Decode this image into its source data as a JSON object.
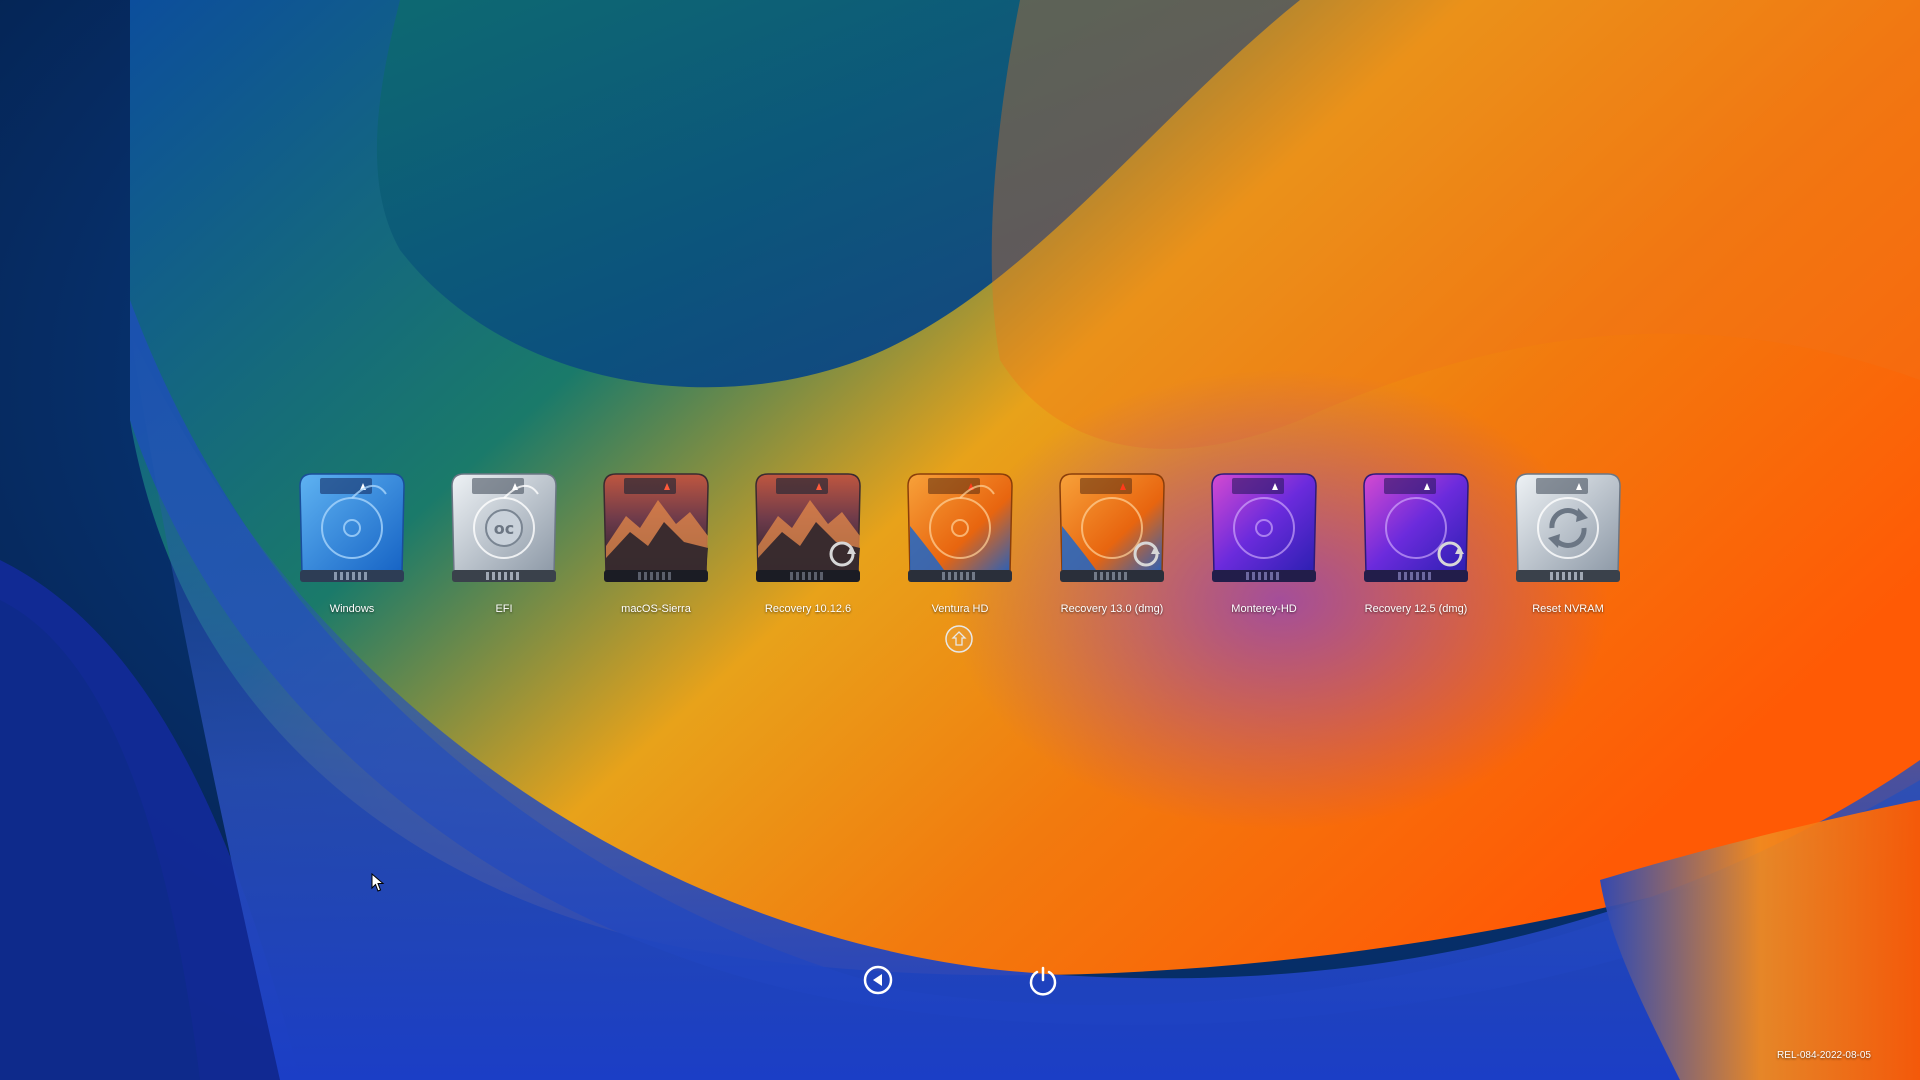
{
  "boot_picker": {
    "entries": [
      {
        "label": "Windows",
        "icon": "hard-drive-icon",
        "theme": "blue"
      },
      {
        "label": "EFI",
        "icon": "opencore-drive-icon",
        "theme": "silver"
      },
      {
        "label": "macOS-Sierra",
        "icon": "sierra-drive-icon",
        "theme": "sierra"
      },
      {
        "label": "Recovery 10.12.6",
        "icon": "sierra-recovery-drive-icon",
        "theme": "sierra"
      },
      {
        "label": "Ventura HD",
        "icon": "ventura-drive-icon",
        "theme": "orange",
        "selected": true
      },
      {
        "label": "Recovery 13.0 (dmg)",
        "icon": "ventura-recovery-drive-icon",
        "theme": "orange"
      },
      {
        "label": "Monterey-HD",
        "icon": "monterey-drive-icon",
        "theme": "purple"
      },
      {
        "label": "Recovery 12.5 (dmg)",
        "icon": "monterey-recovery-drive-icon",
        "theme": "purple"
      },
      {
        "label": "Reset NVRAM",
        "icon": "reset-nvram-icon",
        "theme": "silver"
      }
    ]
  },
  "controls": {
    "back_icon": "back-arrow-icon",
    "power_icon": "power-icon"
  },
  "version": "REL-084-2022-08-05",
  "colors": {
    "blue": "#1f7ad8",
    "orange": "#f07a16",
    "purple": "#6a2bd8",
    "silver": "#b9c3cc",
    "label": "#ffffff"
  }
}
